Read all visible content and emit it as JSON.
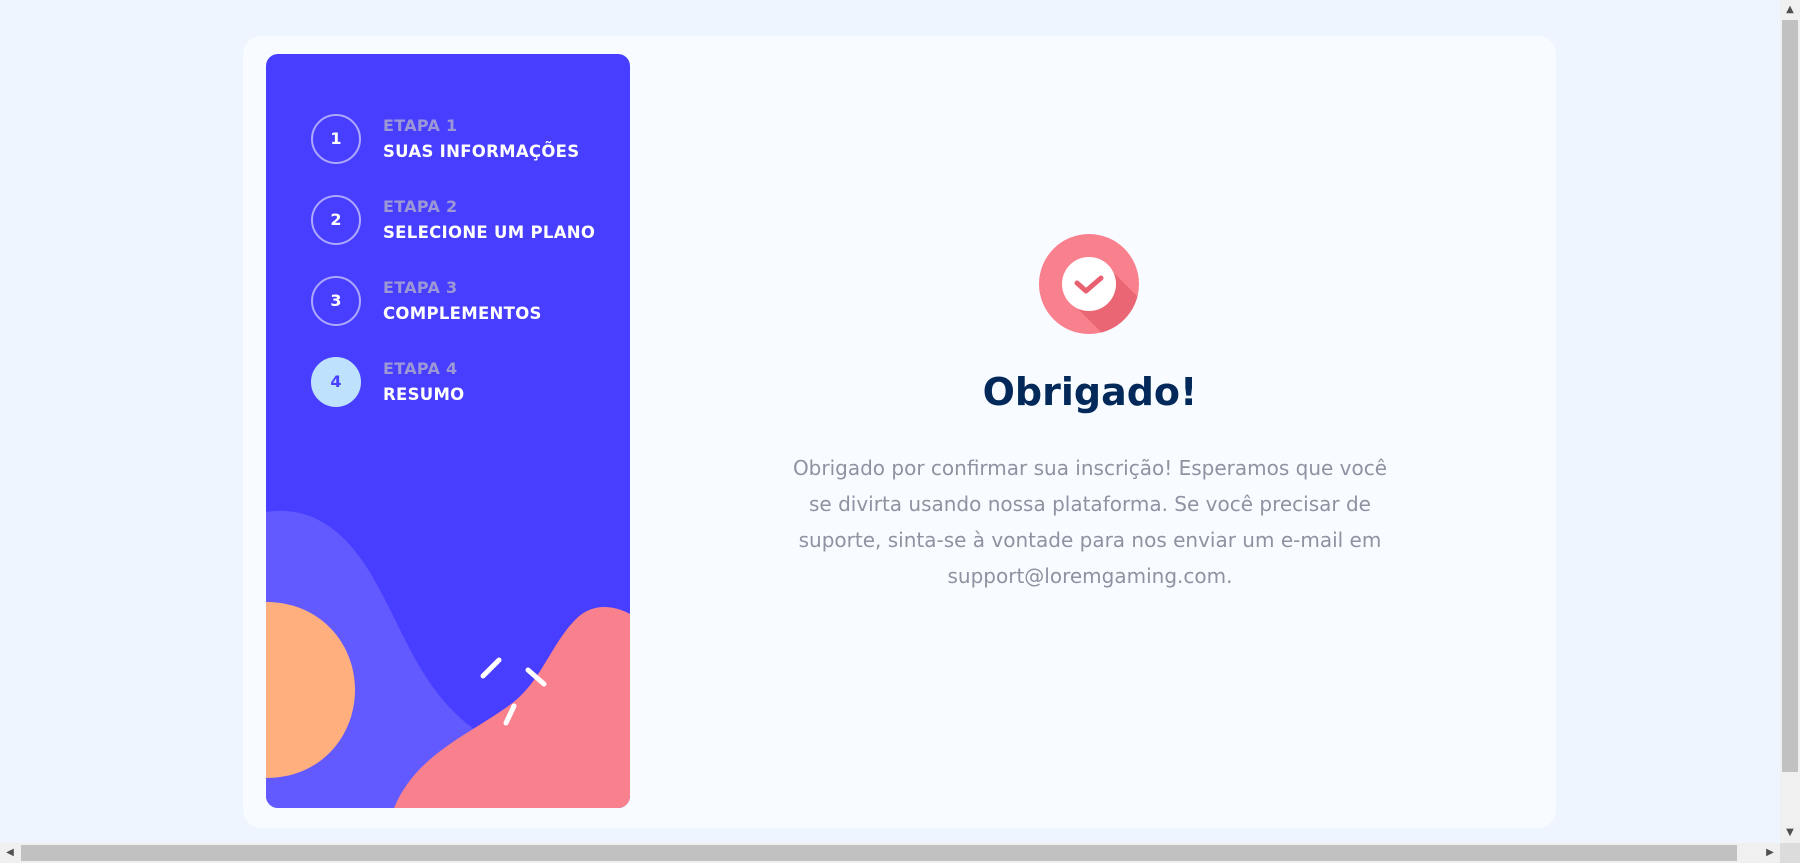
{
  "steps": [
    {
      "number": "1",
      "kicker": "ETAPA 1",
      "title": "SUAS INFORMAÇÕES",
      "active": false
    },
    {
      "number": "2",
      "kicker": "ETAPA 2",
      "title": "SELECIONE UM PLANO",
      "active": false
    },
    {
      "number": "3",
      "kicker": "ETAPA 3",
      "title": "COMPLEMENTOS",
      "active": false
    },
    {
      "number": "4",
      "kicker": "ETAPA 4",
      "title": "RESUMO",
      "active": true
    }
  ],
  "thanks": {
    "icon": "checkmark-icon",
    "title": "Obrigado!",
    "message": "Obrigado por confirmar sua inscrição! Esperamos que você se divirta usando nossa plataforma. Se você precisar de suporte, sinta-se à vontade para nos enviar um e-mail em support@loremgaming.com."
  },
  "colors": {
    "sidebar": "#483eff",
    "active_step": "#bee2fd",
    "title": "#022959",
    "text": "#8f92a1",
    "icon": "#f9818e",
    "card": "#f8fbff",
    "background": "#eef5ff"
  },
  "scrollbars": {
    "up_arrow": "▲",
    "down_arrow": "▼",
    "left_arrow": "◀",
    "right_arrow": "▶"
  }
}
